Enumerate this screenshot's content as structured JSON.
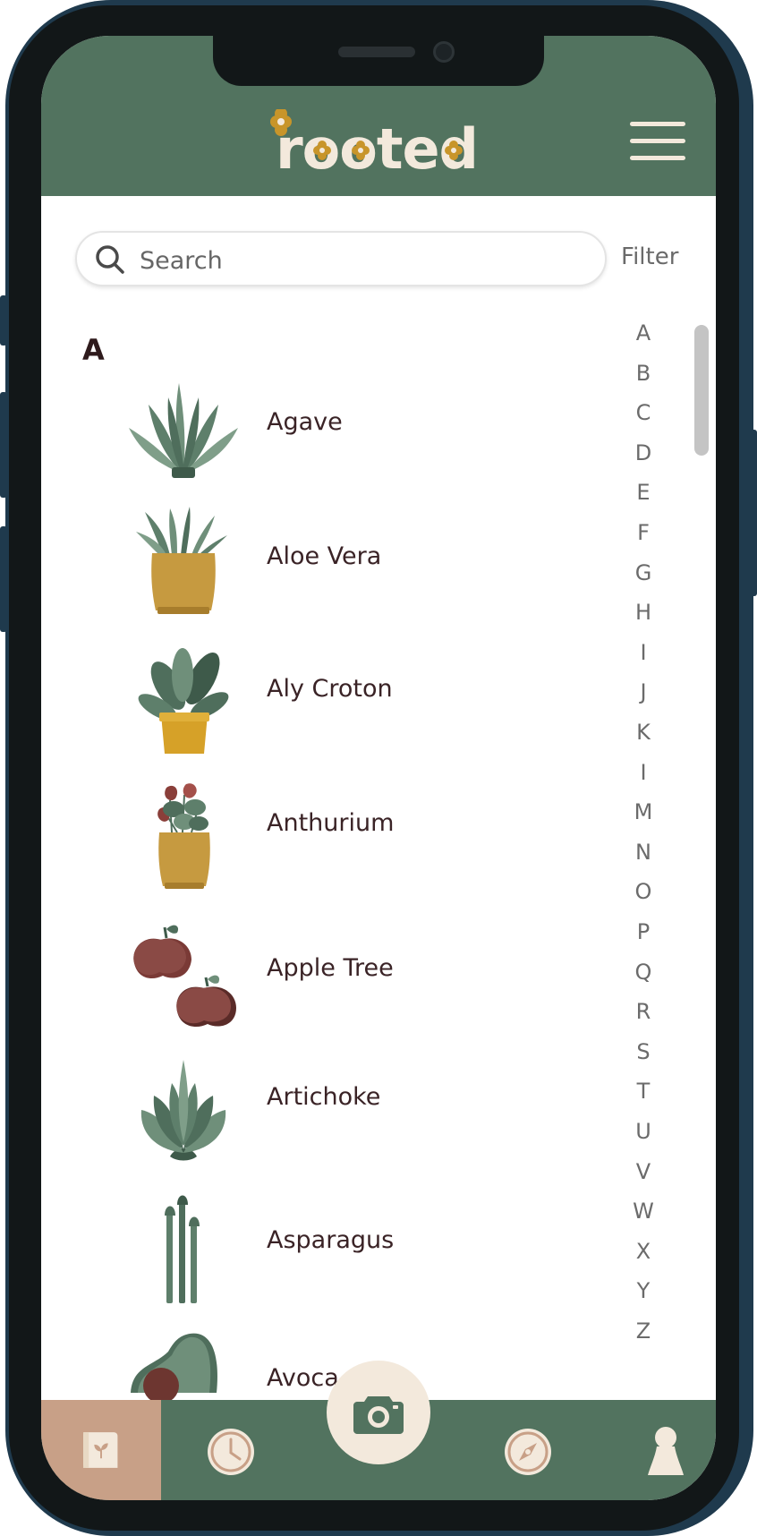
{
  "app": {
    "name": "rooted"
  },
  "search": {
    "placeholder": "Search"
  },
  "filter_label": "Filter",
  "section_letter": "A",
  "plants": [
    {
      "name": "Agave"
    },
    {
      "name": "Aloe Vera"
    },
    {
      "name": "Aly Croton"
    },
    {
      "name": "Anthurium"
    },
    {
      "name": "Apple Tree"
    },
    {
      "name": "Artichoke"
    },
    {
      "name": "Asparagus"
    },
    {
      "name": "Avoca"
    }
  ],
  "alphabet_index": [
    "A",
    "B",
    "C",
    "D",
    "E",
    "F",
    "G",
    "H",
    "I",
    "J",
    "K",
    "I",
    "M",
    "N",
    "O",
    "P",
    "Q",
    "R",
    "S",
    "T",
    "U",
    "V",
    "W",
    "X",
    "Y",
    "Z"
  ],
  "tabs": [
    {
      "name": "plant-journal",
      "icon": "journal-sprout-icon",
      "active": true
    },
    {
      "name": "history",
      "icon": "clock-icon",
      "active": false
    },
    {
      "name": "camera",
      "icon": "camera-icon",
      "active": false
    },
    {
      "name": "explore",
      "icon": "compass-icon",
      "active": false
    },
    {
      "name": "profile",
      "icon": "person-icon",
      "active": false
    }
  ],
  "colors": {
    "header_green": "#52735f",
    "cream": "#f3e9dc",
    "mustard": "#c8952a",
    "text_dark": "#3a2326",
    "active_tab": "#c8a087"
  }
}
